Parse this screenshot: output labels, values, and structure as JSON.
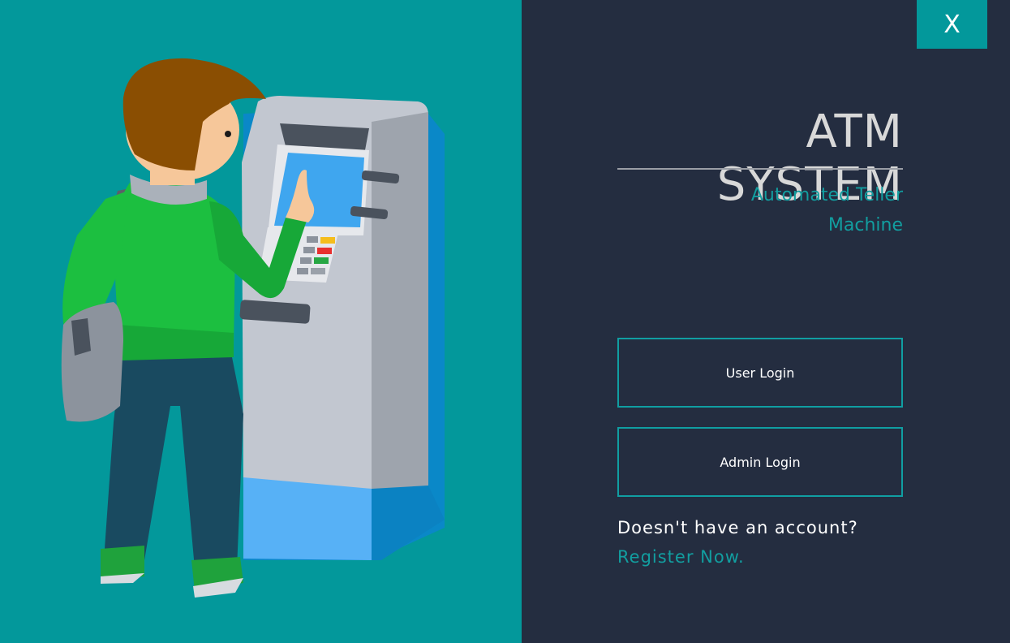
{
  "window": {
    "close_label": "X"
  },
  "header": {
    "title": "ATM SYSTEM",
    "subtitle_line1": "Automated Teller",
    "subtitle_line2": "Machine"
  },
  "buttons": {
    "user_login": "User Login",
    "admin_login": "Admin Login"
  },
  "footer": {
    "prompt": "Doesn't have an account?",
    "register_link": "Register Now."
  },
  "colors": {
    "accent": "#03989b",
    "panel": "#242d40",
    "accent_text": "#129ea0"
  }
}
